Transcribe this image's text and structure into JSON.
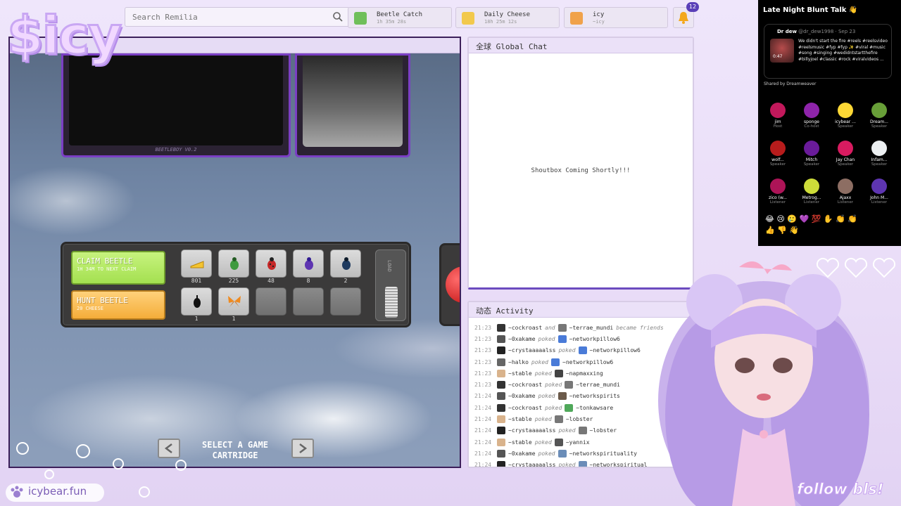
{
  "search": {
    "placeholder": "Search Remilia"
  },
  "chips": [
    {
      "title": "Beetle Catch",
      "subtitle": "1h 35m 28s",
      "color": "#6fbf5a"
    },
    {
      "title": "Daily Cheese",
      "subtitle": "18h 25m 12s",
      "color": "#f2c94c"
    },
    {
      "title": "icy",
      "subtitle": "~icy",
      "color": "#f0a24a"
    }
  ],
  "notifications": {
    "count": "12"
  },
  "game": {
    "screen_label": "BEETLEBOY V0.2",
    "claim": {
      "title": "CLAIM BEETLE",
      "subtitle": "1H 34M TO NEXT CLAIM"
    },
    "hunt": {
      "title": "HUNT BEETLE",
      "subtitle": "20 CHEESE"
    },
    "slots": [
      {
        "icon": "cheese-icon",
        "count": "801"
      },
      {
        "icon": "green-beetle-icon",
        "count": "225"
      },
      {
        "icon": "red-beetle-icon",
        "count": "48"
      },
      {
        "icon": "purple-beetle-icon",
        "count": "8"
      },
      {
        "icon": "blue-beetle-icon",
        "count": "2"
      },
      {
        "icon": "black-beetle-icon",
        "count": "1"
      },
      {
        "icon": "butterfly-icon",
        "count": "1"
      }
    ],
    "load_label": "LOAD",
    "cartridge_prompt": "SELECT A GAME CARTRIDGE"
  },
  "chat": {
    "title": "全球 Global Chat",
    "placeholder": "Shoutbox Coming Shortly!!!"
  },
  "activity": {
    "title": "动态 Activity",
    "rows": [
      {
        "time": "21:23",
        "actor": "~cockroast",
        "verb": "and",
        "target": "~terrae_mundi",
        "suffix": "became friends",
        "c1": "#333",
        "c2": "#777"
      },
      {
        "time": "21:23",
        "actor": "~0xakame",
        "verb": "poked",
        "target": "~networkpillow6",
        "suffix": "",
        "c1": "#555",
        "c2": "#4a7bd8"
      },
      {
        "time": "21:23",
        "actor": "~crystaaaaalss",
        "verb": "poked",
        "target": "~networkpillow6",
        "suffix": "",
        "c1": "#222",
        "c2": "#4a7bd8"
      },
      {
        "time": "21:23",
        "actor": "~halko",
        "verb": "poked",
        "target": "~networkpillow6",
        "suffix": "",
        "c1": "#666",
        "c2": "#4a7bd8"
      },
      {
        "time": "21:23",
        "actor": "~stable",
        "verb": "poked",
        "target": "~napmaxxing",
        "suffix": "",
        "c1": "#d9b38c",
        "c2": "#444"
      },
      {
        "time": "21:23",
        "actor": "~cockroast",
        "verb": "poked",
        "target": "~terrae_mundi",
        "suffix": "",
        "c1": "#333",
        "c2": "#777"
      },
      {
        "time": "21:24",
        "actor": "~0xakame",
        "verb": "poked",
        "target": "~networkspirits",
        "suffix": "",
        "c1": "#555",
        "c2": "#6b5a4a"
      },
      {
        "time": "21:24",
        "actor": "~cockroast",
        "verb": "poked",
        "target": "~tonkawsare",
        "suffix": "",
        "c1": "#333",
        "c2": "#4fa85a"
      },
      {
        "time": "21:24",
        "actor": "~stable",
        "verb": "poked",
        "target": "~lobster",
        "suffix": "",
        "c1": "#d9b38c",
        "c2": "#777"
      },
      {
        "time": "21:24",
        "actor": "~crystaaaaalss",
        "verb": "poked",
        "target": "~lobster",
        "suffix": "",
        "c1": "#222",
        "c2": "#777"
      },
      {
        "time": "21:24",
        "actor": "~stable",
        "verb": "poked",
        "target": "~yannix",
        "suffix": "",
        "c1": "#d9b38c",
        "c2": "#555"
      },
      {
        "time": "21:24",
        "actor": "~0xakame",
        "verb": "poked",
        "target": "~networkspirituality",
        "suffix": "",
        "c1": "#555",
        "c2": "#6b8db8"
      },
      {
        "time": "21:24",
        "actor": "~crystaaaaalss",
        "verb": "poked",
        "target": "~networkspiritual",
        "suffix": "",
        "c1": "#222",
        "c2": "#6b8db8"
      }
    ]
  },
  "spaces": {
    "title": "Late Night Blunt Talk",
    "tweet": {
      "author": "Dr dew",
      "meta": "@dr_dew1998 · Sep 23",
      "time": "0:47",
      "text": "We didn't start the fire #reels #reelsvideo #reelsmusic #fyp #fyp ✨ #viral #music #song #singing #wedidntstartthefire #billyjoel #classic #rock #viralvideos ..."
    },
    "shared_by": "Shared by Dreamweaver",
    "speakers": [
      {
        "name": "jim",
        "role": "Host",
        "color": "#c2185b"
      },
      {
        "name": "sponge",
        "role": "Co-host",
        "color": "#8e24aa"
      },
      {
        "name": "icybear ...",
        "role": "Speaker",
        "color": "#fdd835"
      },
      {
        "name": "Dream...",
        "role": "Speaker",
        "color": "#689f38"
      },
      {
        "name": "wolf...",
        "role": "Speaker",
        "color": "#b71c1c"
      },
      {
        "name": "Mitch",
        "role": "Speaker",
        "color": "#6a1b9a"
      },
      {
        "name": "Jay Chan",
        "role": "Speaker",
        "color": "#d81b60"
      },
      {
        "name": "Infam...",
        "role": "Speaker",
        "color": "#eceff1"
      },
      {
        "name": "zico (w...",
        "role": "Listener",
        "color": "#ad1457"
      },
      {
        "name": "Metrog...",
        "role": "Listener",
        "color": "#cddc39"
      },
      {
        "name": "Ajaxx",
        "role": "Listener",
        "color": "#8d6e63"
      },
      {
        "name": "John M...",
        "role": "Listener",
        "color": "#5e35b1"
      }
    ],
    "reactions": "😂 😢 🥲 💜 💯 ✋ 👏 👏 👍 👎 👋"
  },
  "overlay": {
    "logo": "$icy",
    "site": "icybear.fun",
    "follow": "follow bls!"
  }
}
